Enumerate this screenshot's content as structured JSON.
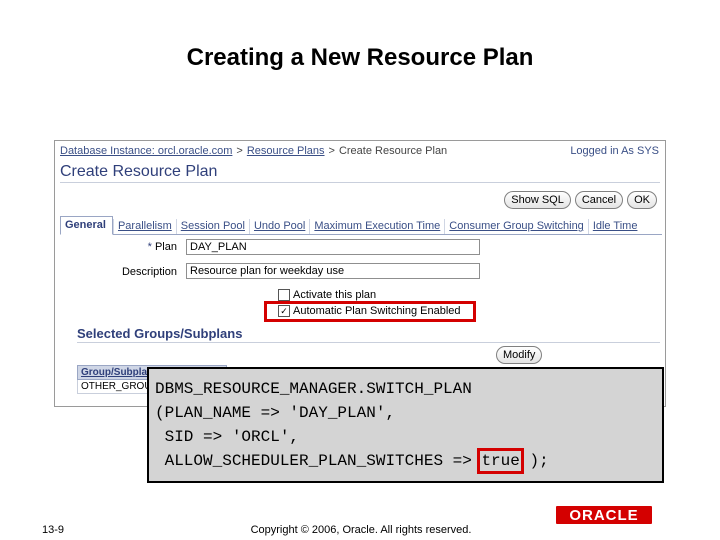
{
  "slide": {
    "title": "Creating a New Resource Plan",
    "page_number": "13-9",
    "copyright": "Copyright © 2006, Oracle. All rights reserved.",
    "logo_text": "ORACLE"
  },
  "screen": {
    "breadcrumb": {
      "items": [
        "Database Instance: orcl.oracle.com",
        "Resource Plans"
      ],
      "current": "Create Resource Plan",
      "separator": ">"
    },
    "logged_in": "Logged in As SYS",
    "page_title": "Create Resource Plan",
    "buttons": {
      "show_sql": "Show SQL",
      "cancel": "Cancel",
      "ok": "OK",
      "modify": "Modify"
    },
    "tabs": [
      {
        "label": "General",
        "active": true
      },
      {
        "label": "Parallelism"
      },
      {
        "label": "Session Pool"
      },
      {
        "label": "Undo Pool"
      },
      {
        "label": "Maximum Execution Time"
      },
      {
        "label": "Consumer Group Switching"
      },
      {
        "label": "Idle Time"
      }
    ],
    "form": {
      "plan_label": "Plan",
      "required_marker": "*",
      "plan_value": "DAY_PLAN",
      "description_label": "Description",
      "description_value": "Resource plan for weekday use",
      "activate_label": "Activate this plan",
      "activate_checked": false,
      "auto_switch_label": "Automatic Plan Switching Enabled",
      "auto_switch_checked": true
    },
    "groups_section": {
      "title": "Selected Groups/Subplans",
      "column_header": "Group/Subplan",
      "rows": [
        "OTHER_GROUPS"
      ]
    },
    "code": {
      "lines": [
        "DBMS_RESOURCE_MANAGER.SWITCH_PLAN",
        "(PLAN_NAME => 'DAY_PLAN',",
        " SID => 'ORCL',",
        " ALLOW_SCHEDULER_PLAN_SWITCHES => "
      ],
      "highlight": "true",
      "tail": " );"
    }
  },
  "colors": {
    "accent_red": "#d40000",
    "oracle_blue": "#2f3f7a"
  }
}
